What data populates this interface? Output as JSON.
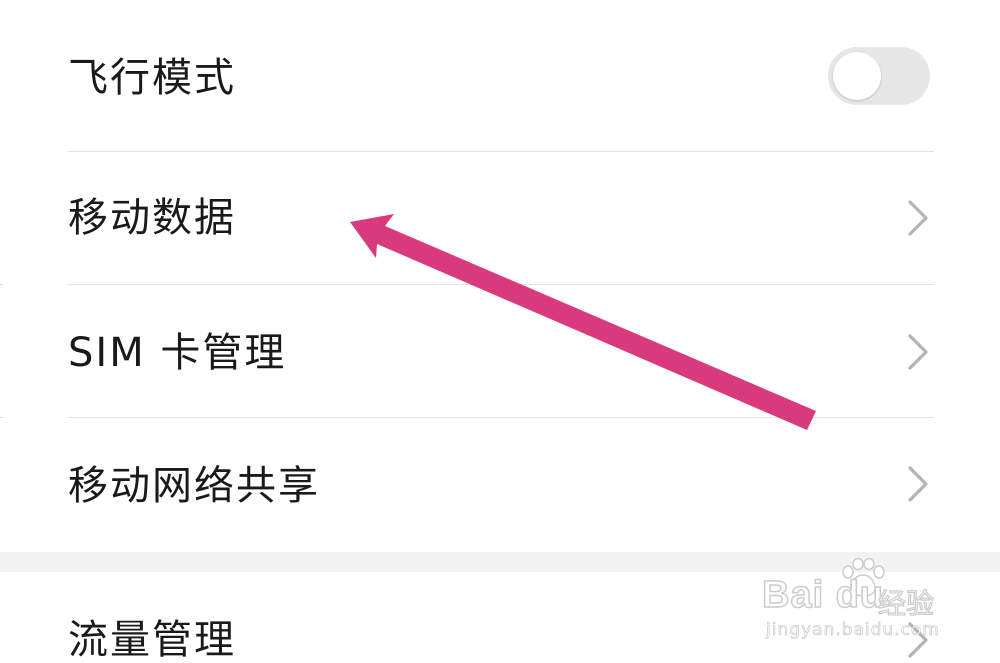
{
  "settings": {
    "items": [
      {
        "label": "飞行模式",
        "control": "toggle",
        "toggle_on": false
      },
      {
        "label": "移动数据",
        "control": "chevron"
      },
      {
        "label": "SIM 卡管理",
        "control": "chevron"
      },
      {
        "label": "移动网络共享",
        "control": "chevron"
      },
      {
        "label": "流量管理",
        "control": "chevron"
      }
    ]
  },
  "annotation": {
    "arrow_color": "#d93a7e",
    "points_to": "移动数据"
  },
  "watermark": {
    "brand": "Bai du",
    "brand_suffix": "经验",
    "url": "jingyan.baidu.com",
    "icon": "baidu-paw-icon"
  },
  "colors": {
    "background": "#ffffff",
    "text": "#1a1a1a",
    "divider": "#e3e3e3",
    "chevron": "#b3b3b3",
    "toggle_off_track": "#e6e6e6",
    "section_gap": "#f2f2f2"
  }
}
